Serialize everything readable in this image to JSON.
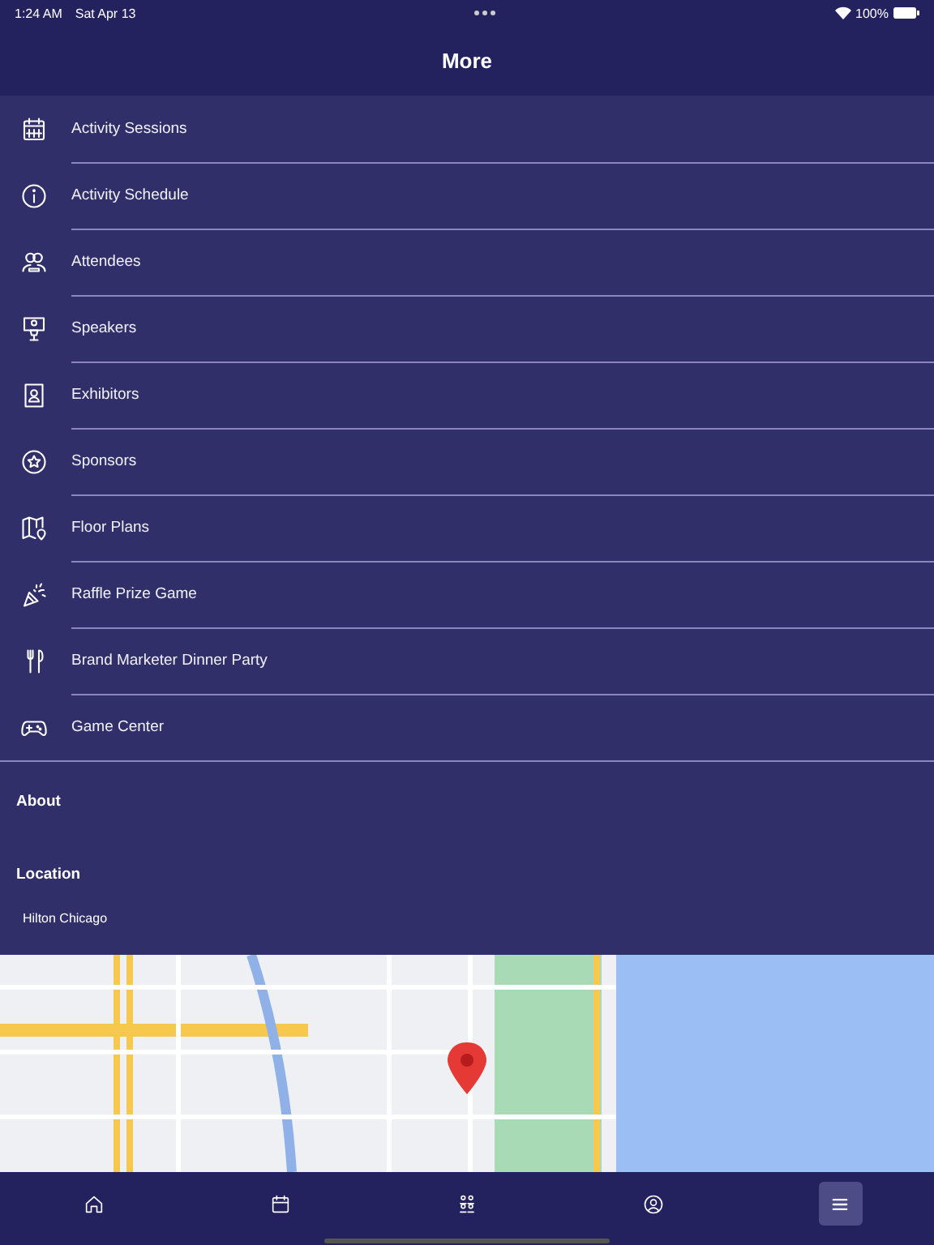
{
  "status_bar": {
    "time": "1:24 AM",
    "date": "Sat Apr 13",
    "battery": "100%"
  },
  "header": {
    "title": "More"
  },
  "menu_items": [
    {
      "label": "Activity Sessions"
    },
    {
      "label": "Activity Schedule"
    },
    {
      "label": "Attendees"
    },
    {
      "label": "Speakers"
    },
    {
      "label": "Exhibitors"
    },
    {
      "label": "Sponsors"
    },
    {
      "label": "Floor Plans"
    },
    {
      "label": "Raffle Prize Game"
    },
    {
      "label": "Brand Marketer Dinner Party"
    },
    {
      "label": "Game Center"
    }
  ],
  "about": {
    "heading": "About"
  },
  "location": {
    "heading": "Location",
    "name": "Hilton Chicago"
  },
  "tab_bar": [
    {
      "selected": false
    },
    {
      "selected": false
    },
    {
      "selected": false
    },
    {
      "selected": false
    },
    {
      "selected": true
    }
  ]
}
